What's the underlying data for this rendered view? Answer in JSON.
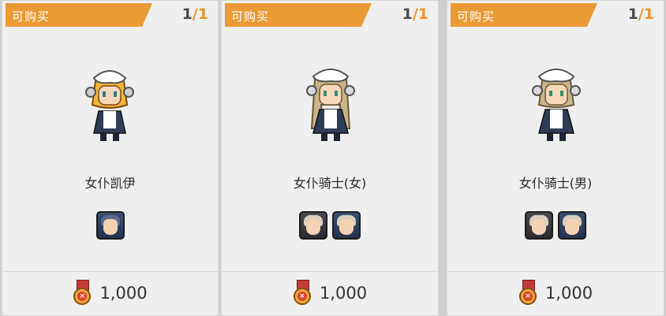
{
  "cards": [
    {
      "status": "可购买",
      "count": {
        "current": "1",
        "sep": "/",
        "max": "1"
      },
      "name": "女仆凯伊",
      "hair_color": "#f2b63a",
      "icon_hair_colors": [
        "#5a6b8c"
      ],
      "price": "1,000"
    },
    {
      "status": "可购买",
      "count": {
        "current": "1",
        "sep": "/",
        "max": "1"
      },
      "name": "女仆骑士(女)",
      "hair_color": "#c9b58b",
      "icon_hair_colors": [
        "#d8cfc2",
        "#d8cfc2"
      ],
      "price": "1,000"
    },
    {
      "status": "可购买",
      "count": {
        "current": "1",
        "sep": "/",
        "max": "1"
      },
      "name": "女仆骑士(男)",
      "hair_color": "#c9b58b",
      "icon_hair_colors": [
        "#d8cfc2",
        "#d8cfc2"
      ],
      "price": "1,000"
    }
  ],
  "icons": {
    "portrait": "maid-character-sprite-icon",
    "skin_icon": "character-skin-icon",
    "currency": "medal-currency-icon"
  },
  "colors": {
    "ribbon": "#ea9a35",
    "count_accent": "#e8942c",
    "card_bg": "#efefef"
  }
}
